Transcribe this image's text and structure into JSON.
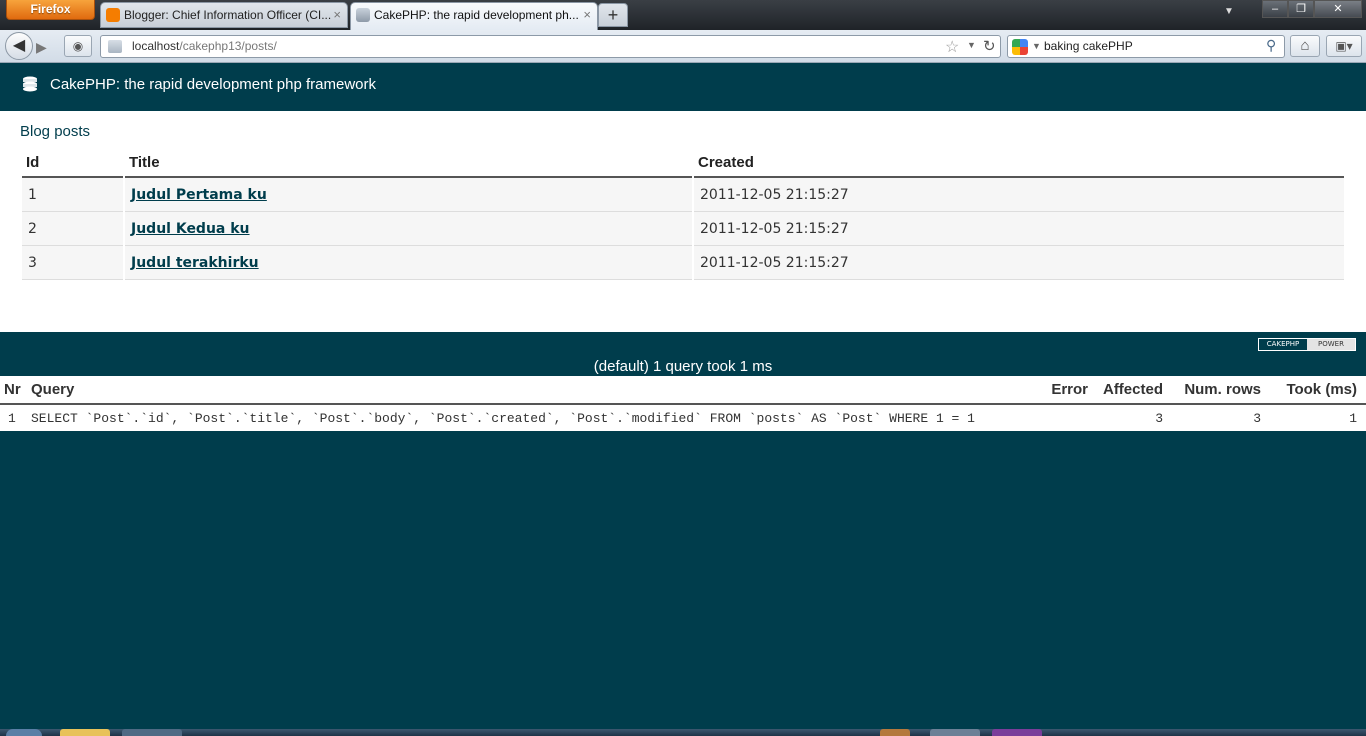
{
  "browser": {
    "menu_label": "Firefox",
    "tabs": [
      {
        "label": "Blogger: Chief Information Officer (CI...",
        "close": "×"
      },
      {
        "label": "CakePHP: the rapid development ph...",
        "close": "×"
      }
    ],
    "new_tab": "+",
    "url_host": "localhost",
    "url_path": "/cakephp13/posts/",
    "search_value": "baking cakePHP"
  },
  "header": {
    "title": "CakePHP: the rapid development php framework"
  },
  "page": {
    "heading": "Blog posts",
    "columns": [
      "Id",
      "Title",
      "Created"
    ],
    "rows": [
      {
        "id": "1",
        "title": "Judul Pertama ku",
        "created": "2011-12-05 21:15:27"
      },
      {
        "id": "2",
        "title": "Judul Kedua ku",
        "created": "2011-12-05 21:15:27"
      },
      {
        "id": "3",
        "title": "Judul terakhirku",
        "created": "2011-12-05 21:15:27"
      }
    ]
  },
  "powered_badge": {
    "left": "CAKEPHP",
    "right": "POWER"
  },
  "sql_log": {
    "caption": "(default) 1 query took 1 ms",
    "columns": [
      "Nr",
      "Query",
      "Error",
      "Affected",
      "Num. rows",
      "Took (ms)"
    ],
    "rows": [
      {
        "nr": "1",
        "query": "SELECT `Post`.`id`, `Post`.`title`, `Post`.`body`, `Post`.`created`, `Post`.`modified` FROM `posts` AS `Post` WHERE 1 = 1",
        "error": "",
        "affected": "3",
        "num_rows": "3",
        "took": "1"
      }
    ]
  },
  "colors": {
    "cake_dark": "#003d4c",
    "firefox_orange": "#e66000"
  }
}
